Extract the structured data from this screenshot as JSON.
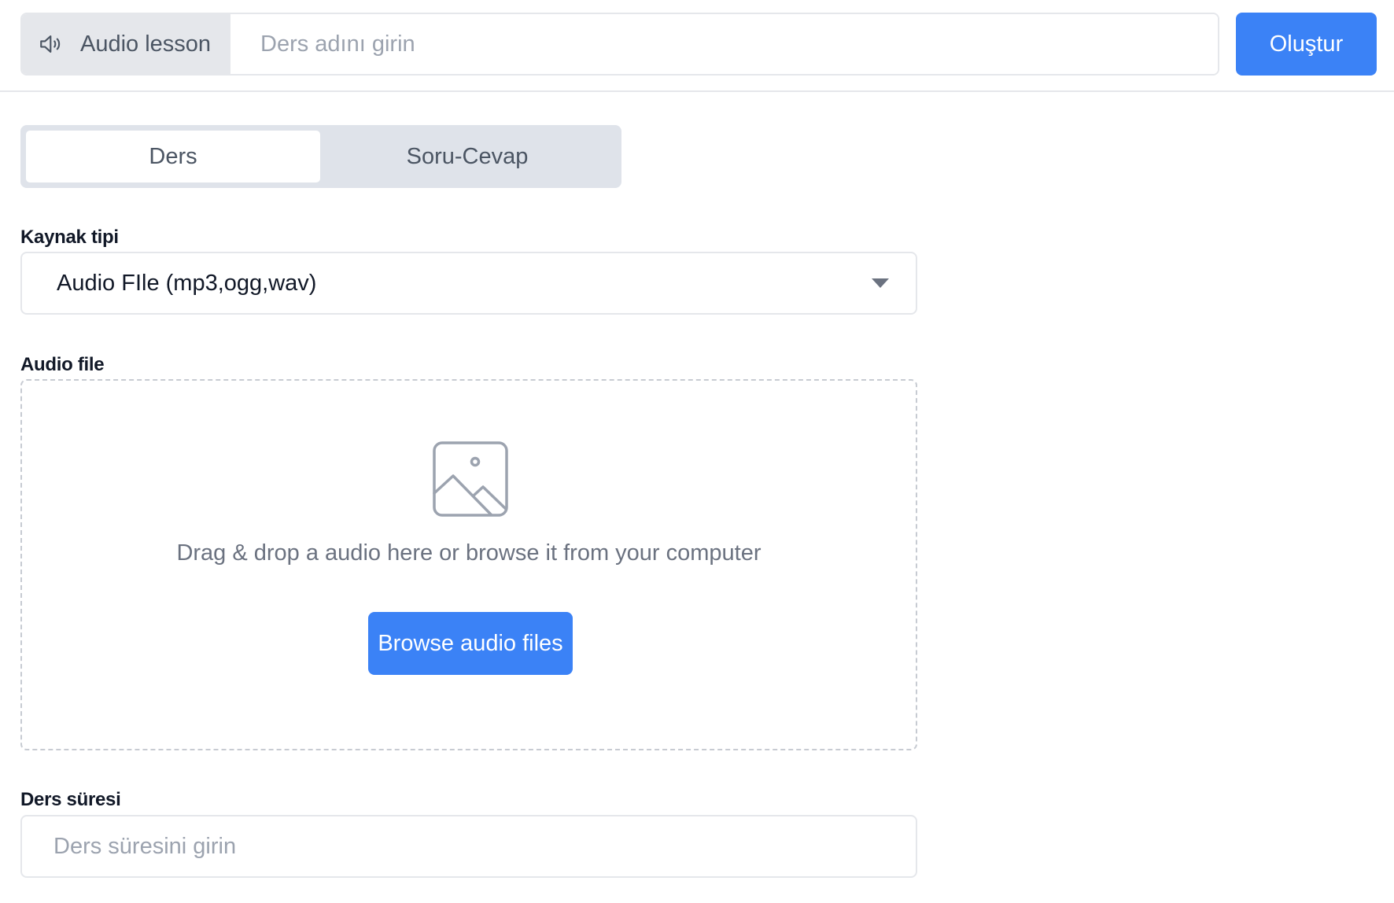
{
  "header": {
    "type_label": "Audio lesson",
    "type_icon": "speaker-icon",
    "title_placeholder": "Ders adını girin",
    "title_value": "",
    "create_label": "Oluştur"
  },
  "tabs": [
    {
      "label": "Ders",
      "active": true
    },
    {
      "label": "Soru-Cevap",
      "active": false
    }
  ],
  "source_type": {
    "label": "Kaynak tipi",
    "selected": "Audio FIle (mp3,ogg,wav)"
  },
  "audio_file": {
    "label": "Audio file",
    "icon": "image-icon",
    "drop_text": "Drag & drop a audio here or browse it from your computer",
    "browse_label": "Browse audio files"
  },
  "duration": {
    "label": "Ders süresi",
    "placeholder": "Ders süresini girin",
    "value": ""
  },
  "colors": {
    "accent": "#3b82f6",
    "border": "#e5e7eb",
    "muted_text": "#9ca3af"
  }
}
